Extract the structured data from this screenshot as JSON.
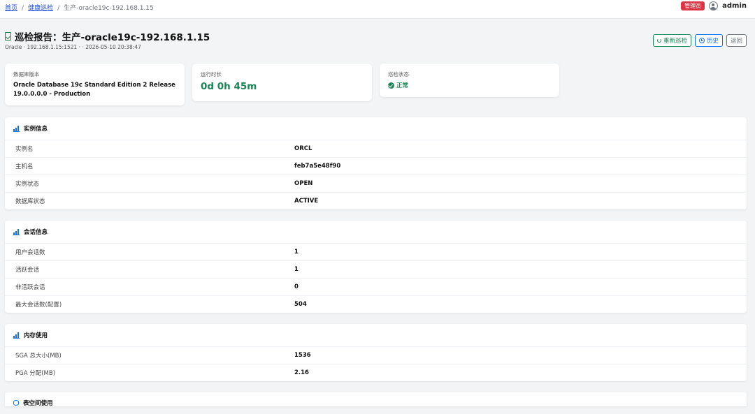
{
  "breadcrumb": {
    "home": "首页",
    "inspection": "健康巡检",
    "current": "生产-oracle19c-192.168.1.15"
  },
  "user": {
    "role_badge": "管理员",
    "name": "admin"
  },
  "page": {
    "title": "巡检报告：生产-oracle19c-192.168.1.15",
    "subtitle": "Oracle · 192.168.1.15:1521 · · 2026-05-10 20:38:47"
  },
  "actions": {
    "rerun": "重新巡检",
    "history": "历史",
    "back": "返回"
  },
  "stats": [
    {
      "label": "数据库版本",
      "value": "Oracle Database 19c Standard Edition 2 Release 19.0.0.0.0 - Production"
    },
    {
      "label": "运行时长",
      "value": "0d 0h 45m"
    },
    {
      "label": "巡检状态",
      "value": "正常"
    }
  ],
  "sections": [
    {
      "title": "实例信息",
      "rows": [
        {
          "label": "实例名",
          "value": "ORCL"
        },
        {
          "label": "主机名",
          "value": "feb7a5e48f90"
        },
        {
          "label": "实例状态",
          "value": "OPEN"
        },
        {
          "label": "数据库状态",
          "value": "ACTIVE"
        }
      ]
    },
    {
      "title": "会话信息",
      "rows": [
        {
          "label": "用户会话数",
          "value": "1"
        },
        {
          "label": "活跃会话",
          "value": "1"
        },
        {
          "label": "非活跃会话",
          "value": "0"
        },
        {
          "label": "最大会话数(配置)",
          "value": "504"
        }
      ]
    },
    {
      "title": "内存使用",
      "rows": [
        {
          "label": "SGA 总大小(MB)",
          "value": "1536"
        },
        {
          "label": "PGA 分配(MB)",
          "value": "2.16"
        }
      ]
    },
    {
      "title": "表空间使用",
      "rows": []
    }
  ],
  "colors": {
    "success": "#198754",
    "primary": "#0d6efd",
    "danger": "#dc3545"
  }
}
